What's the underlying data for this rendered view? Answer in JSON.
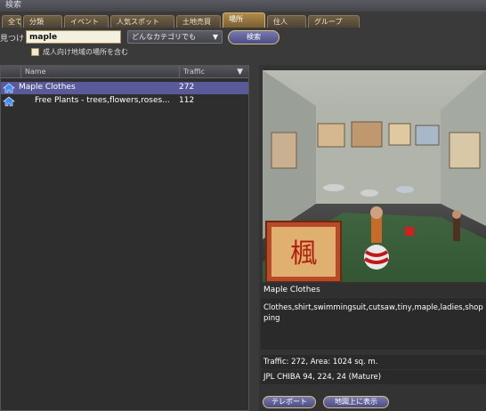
{
  "window": {
    "title": "検索"
  },
  "tabs": [
    {
      "label": "全て"
    },
    {
      "label": "分類"
    },
    {
      "label": "イベント"
    },
    {
      "label": "人気スポット"
    },
    {
      "label": "土地売買"
    },
    {
      "label": "場所"
    },
    {
      "label": "住人"
    },
    {
      "label": "グループ"
    }
  ],
  "active_tab": "場所",
  "search": {
    "find_label": "見つけ",
    "query_value": "maple",
    "category_value": "どんなカテゴリでも",
    "search_button_label": "検索",
    "mature_label": "成人向け地域の場所を含む"
  },
  "results": {
    "columns": {
      "name": "Name",
      "traffic": "Traffic"
    },
    "rows": [
      {
        "name": "Maple Clothes",
        "traffic": "272"
      },
      {
        "name": "Free Plants - trees,flowers,roses...",
        "traffic": "112"
      }
    ]
  },
  "details": {
    "name": "Maple Clothes",
    "description": "Clothes,shirt,swimmingsuit,cutsaw,tiny,maple,ladies,shopping",
    "traffic_area": "Traffic: 272, Area: 1024 sq. m.",
    "location": "JPL CHIBA 94, 224, 24 (Mature)",
    "teleport_button": "テレポート",
    "map_button": "地図上に表示",
    "preview_sign_text": "楓"
  },
  "colors": {
    "accent_tab": "#b08a4a",
    "selected_row": "#5a5a9a",
    "button": "#4c4c86",
    "button_border": "#d8c080"
  },
  "icons": [
    "house-icon",
    "sort-arrow-icon",
    "dropdown-arrow-icon"
  ]
}
